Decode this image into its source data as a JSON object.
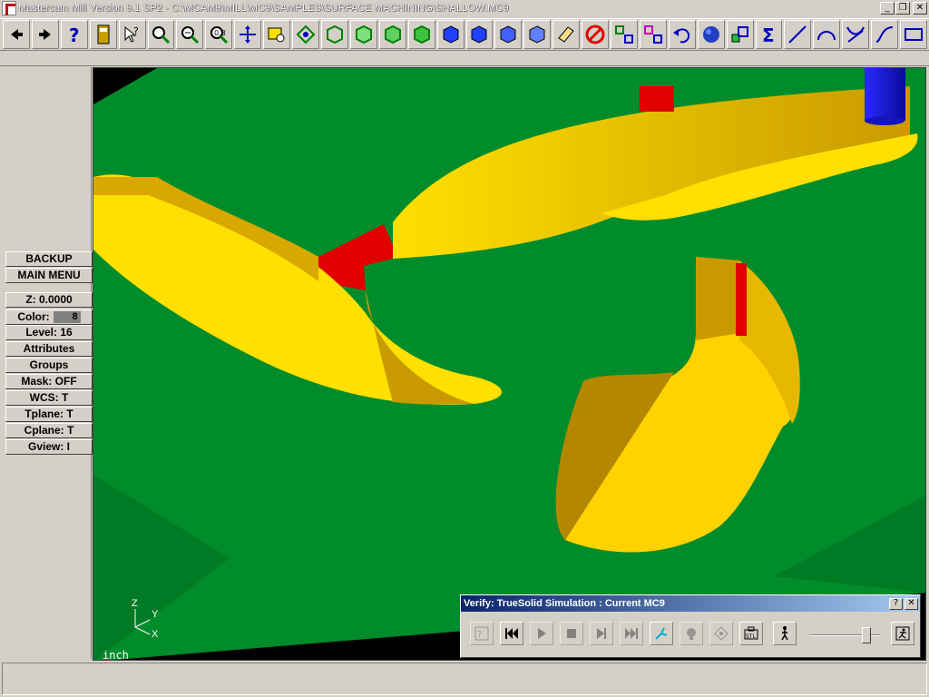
{
  "window": {
    "title": "Mastercam Mill Version 9.1 SP2 - C:\\MCAM9\\MILL\\MC9\\SAMPLES\\SURFACE MACHINING\\SHALLOW.MC9",
    "minimize": "_",
    "restore": "❐",
    "close": "✕"
  },
  "toolbar": {
    "icons": [
      "back-arrow-icon",
      "forward-arrow-icon",
      "help-icon",
      "calculator-icon",
      "cursor-help-icon",
      "zoom-window-icon",
      "zoom-out-icon",
      "zoom-fit-icon",
      "pan-icon",
      "select-zoom-icon",
      "dynamic-rotate-icon",
      "view-top-icon",
      "view-front-icon",
      "view-side-icon",
      "view-iso-icon",
      "shade-cube-icon",
      "shade-cube-2-icon",
      "shade-cube-3-icon",
      "shade-cube-4-icon",
      "eraser-icon",
      "no-entity-icon",
      "transform-icon",
      "transform-2-icon",
      "undo-icon",
      "sphere-icon",
      "group-icon",
      "sigma-icon",
      "line-icon",
      "arc-icon",
      "trim-icon",
      "spline-icon",
      "rectangle-icon"
    ]
  },
  "menu": {
    "backup": "BACKUP",
    "main_menu": "MAIN MENU",
    "z_label": "Z:  0.0000",
    "color_label": "Color:",
    "color_value": "8",
    "level": "Level: 16",
    "attributes": "Attributes",
    "groups": "Groups",
    "mask": "Mask:  OFF",
    "wcs": "WCS:   T",
    "tplane": "Tplane:  T",
    "cplane": "Cplane:  T",
    "gview": "Gview:   I"
  },
  "viewport": {
    "units": "inch",
    "axis_z": "Z",
    "axis_y": "Y",
    "axis_x": "X",
    "colors": {
      "floor": "#008c2a",
      "floor_shadow": "#00701f",
      "wall": "#e6b800",
      "wall_light": "#ffe000",
      "gouge": "#e00000",
      "tool": "#1515e0"
    }
  },
  "verify": {
    "title": "Verify: TrueSolid Simulation : Current MC9",
    "help": "?",
    "close": "✕",
    "slider_level": 0.85
  }
}
